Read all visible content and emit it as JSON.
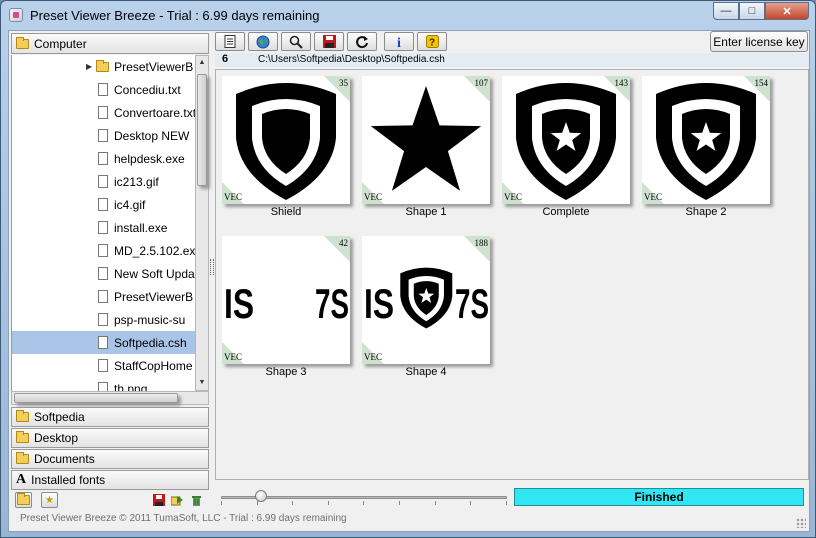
{
  "window": {
    "title": "Preset Viewer Breeze - Trial : 6.99 days remaining"
  },
  "tree": {
    "root_label": "Computer",
    "items": [
      {
        "label": "PresetViewerB",
        "type": "folder",
        "expanded": false
      },
      {
        "label": "Concediu.txt",
        "type": "file"
      },
      {
        "label": "Convertoare.txt",
        "type": "file"
      },
      {
        "label": "Desktop NEW",
        "type": "file"
      },
      {
        "label": "helpdesk.exe",
        "type": "file"
      },
      {
        "label": "ic213.gif",
        "type": "file"
      },
      {
        "label": "ic4.gif",
        "type": "file"
      },
      {
        "label": "install.exe",
        "type": "file"
      },
      {
        "label": "MD_2.5.102.ex",
        "type": "file"
      },
      {
        "label": "New Soft Upda",
        "type": "file"
      },
      {
        "label": "PresetViewerB",
        "type": "file"
      },
      {
        "label": "psp-music-su",
        "type": "file"
      },
      {
        "label": "Softpedia.csh",
        "type": "file",
        "selected": true
      },
      {
        "label": "StaffCopHome",
        "type": "file"
      },
      {
        "label": "th.png",
        "type": "file"
      }
    ]
  },
  "favorites": [
    {
      "label": "Softpedia",
      "icon": "folder-icon"
    },
    {
      "label": "Desktop",
      "icon": "folder-icon"
    },
    {
      "label": "Documents",
      "icon": "folder-icon"
    },
    {
      "label": "Installed fonts",
      "icon": "font-icon"
    }
  ],
  "toolbar": {
    "buttons": [
      "list-icon",
      "globe-icon",
      "magnifier-icon",
      "save-icon",
      "refresh-icon",
      "info-icon",
      "help-icon"
    ],
    "license_label": "Enter license key"
  },
  "pathbar": {
    "count": "6",
    "path": "C:\\Users\\Softpedia\\Desktop\\Softpedia.csh"
  },
  "presets": [
    {
      "name": "Shield",
      "number": "35",
      "tag": "VEC",
      "glyph": "shield"
    },
    {
      "name": "Shape 1",
      "number": "107",
      "tag": "VEC",
      "glyph": "star"
    },
    {
      "name": "Complete",
      "number": "143",
      "tag": "VEC",
      "glyph": "shield-star"
    },
    {
      "name": "Shape 2",
      "number": "154",
      "tag": "VEC",
      "glyph": "shield-star"
    },
    {
      "name": "Shape 3",
      "number": "42",
      "tag": "VEC",
      "glyph": "text",
      "text_left": "IS",
      "text_right": "7S"
    },
    {
      "name": "Shape 4",
      "number": "188",
      "tag": "VEC",
      "glyph": "text-shield",
      "text_left": "IS",
      "text_right": "7S"
    }
  ],
  "status": {
    "text": "Finished",
    "color": "#2fe6f2"
  },
  "slider": {
    "value_fraction": 0.14
  },
  "footer": {
    "text": "Preset Viewer Breeze © 2011 TumaSoft, LLC - Trial : 6.99 days remaining"
  }
}
